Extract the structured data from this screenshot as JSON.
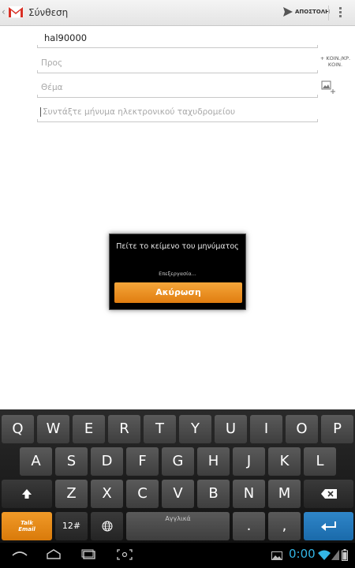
{
  "actionbar": {
    "title": "Σύνθεση",
    "send_label": "ΑΠΟΣΤΟΛΗ"
  },
  "compose": {
    "from": "hal90000",
    "to_placeholder": "Προς",
    "subject_placeholder": "Θέμα",
    "body_placeholder": "Συντάξτε μήνυμα ηλεκτρονικού ταχυδρομείου",
    "cc_bcc_label_line1": "+ ΚΟΙΝ./ΚΡ.",
    "cc_bcc_label_line2": "ΚΟΙΝ."
  },
  "dialog": {
    "title": "Πείτε το κείμενο του μηνύματος",
    "status": "Επεξεργασία...",
    "cancel_label": "Ακύρωση"
  },
  "keyboard": {
    "row1": [
      "Q",
      "W",
      "E",
      "R",
      "T",
      "Y",
      "U",
      "I",
      "O",
      "P"
    ],
    "row2": [
      "A",
      "S",
      "D",
      "F",
      "G",
      "H",
      "J",
      "K",
      "L"
    ],
    "row3": [
      "Z",
      "X",
      "C",
      "V",
      "B",
      "N",
      "M"
    ],
    "talk_label_line1": "Talk",
    "talk_label_line2": "Email",
    "symbols_label": "12#",
    "space_label": "Αγγλικά",
    "period_label": ".",
    "comma_label": ","
  },
  "status": {
    "time": "0:00"
  },
  "colors": {
    "accent_orange": "#e8881a",
    "enter_blue": "#2479bd",
    "clock_blue": "#33b5e5"
  }
}
